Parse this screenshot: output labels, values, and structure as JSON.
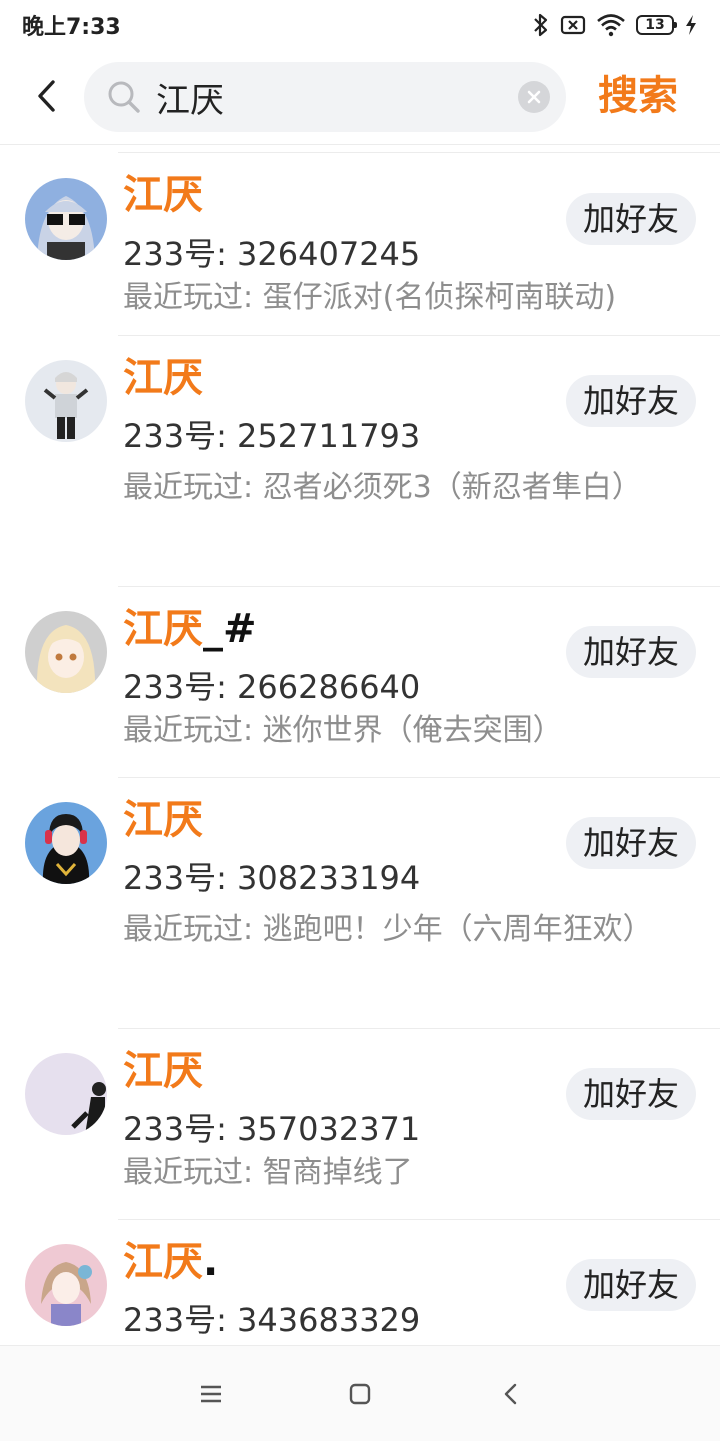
{
  "status_bar": {
    "time": "晚上7:33",
    "battery_level": "13"
  },
  "search": {
    "query": "江厌",
    "submit_label": "搜索"
  },
  "results": [
    {
      "name": "江厌",
      "name_suffix": "",
      "id_text": "233号: 326407245",
      "played": "最近玩过: 蛋仔派对(名侦探柯南联动)",
      "add_label": "加好友",
      "avatar_color": "#8fb0e0"
    },
    {
      "name": "江厌",
      "name_suffix": "",
      "id_text": "233号: 252711793",
      "played": "最近玩过: 忍者必须死3（新忍者隼白）",
      "add_label": "加好友",
      "avatar_color": "#e5e9ef"
    },
    {
      "name": "江厌",
      "name_suffix": "_#",
      "id_text": "233号: 266286640",
      "played": "最近玩过: 迷你世界（俺去突围）",
      "add_label": "加好友",
      "avatar_color": "#cfcfcf"
    },
    {
      "name": "江厌",
      "name_suffix": "",
      "id_text": "233号: 308233194",
      "played": "最近玩过: 逃跑吧！少年（六周年狂欢）",
      "add_label": "加好友",
      "avatar_color": "#6aa3de"
    },
    {
      "name": "江厌",
      "name_suffix": "",
      "id_text": "233号: 357032371",
      "played": "最近玩过: 智商掉线了",
      "add_label": "加好友",
      "avatar_color": "#e6e0ee"
    },
    {
      "name": "江厌",
      "name_suffix": ".",
      "id_text": "233号: 343683329",
      "played": "",
      "add_label": "加好友",
      "avatar_color": "#efc9d3"
    }
  ],
  "colors": {
    "accent": "#f27a1a",
    "button_bg": "#eef0f4",
    "secondary_text": "#8e8e8e"
  }
}
